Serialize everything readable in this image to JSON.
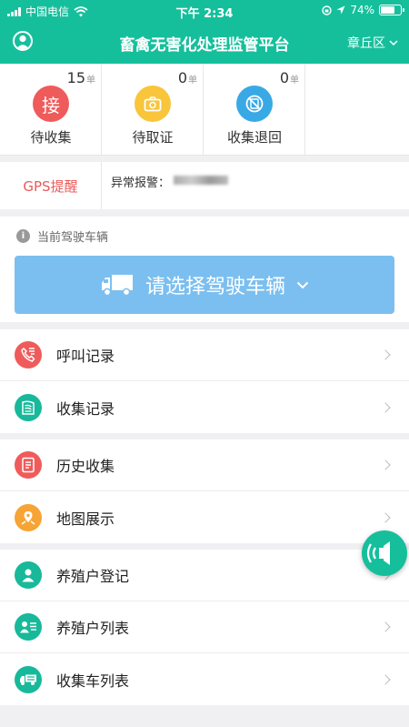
{
  "status_bar": {
    "carrier": "中国电信",
    "time": "下午 2:34",
    "battery": "74%",
    "battery_level": 0.74
  },
  "nav": {
    "title": "畜禽无害化处理监管平台",
    "region": "章丘区"
  },
  "counters": [
    {
      "count": "15",
      "unit": "单",
      "icon_char": "接",
      "label": "待收集",
      "color": "#ef5b5b",
      "icon": "receive-icon"
    },
    {
      "count": "0",
      "unit": "单",
      "icon_char": "",
      "label": "待取证",
      "color": "#f8c53b",
      "icon": "camera-icon"
    },
    {
      "count": "0",
      "unit": "单",
      "icon_char": "",
      "label": "收集退回",
      "color": "#39a9e6",
      "icon": "return-icon"
    }
  ],
  "gps": {
    "label": "GPS提醒",
    "alarm_label": "异常报警："
  },
  "vehicle": {
    "caption": "当前驾驶车辆",
    "select_label": "请选择驾驶车辆"
  },
  "menu_groups": [
    [
      {
        "label": "呼叫记录",
        "icon": "phone-icon"
      },
      {
        "label": "收集记录",
        "icon": "collect-record-icon"
      }
    ],
    [
      {
        "label": "历史收集",
        "icon": "history-icon"
      },
      {
        "label": "地图展示",
        "icon": "map-icon"
      }
    ],
    [
      {
        "label": "养殖户登记",
        "icon": "farmer-register-icon"
      },
      {
        "label": "养殖户列表",
        "icon": "farmer-list-icon"
      },
      {
        "label": "收集车列表",
        "icon": "vehicle-list-icon"
      }
    ]
  ]
}
